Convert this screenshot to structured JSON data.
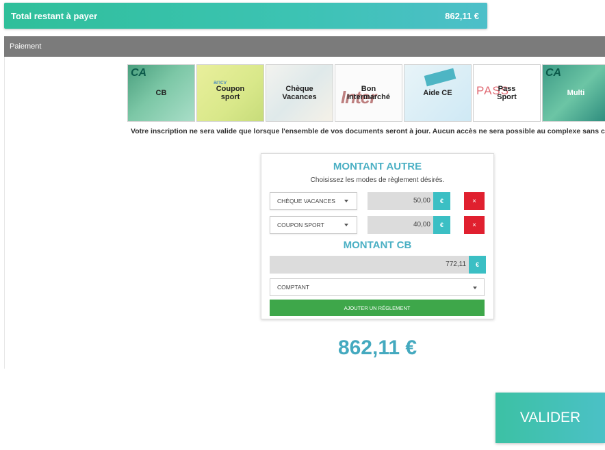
{
  "total": {
    "label": "Total restant à payer",
    "amount": "862,11 €"
  },
  "section": {
    "title": "Paiement"
  },
  "payment_methods": [
    {
      "label": "CB"
    },
    {
      "label": "Coupon\nsport"
    },
    {
      "label": "Chèque\nVacances"
    },
    {
      "label": "Bon\nIntermarché"
    },
    {
      "label": "Aide CE"
    },
    {
      "label": "Pass\nSport"
    },
    {
      "label": "Multi"
    }
  ],
  "notice": "Votre inscription ne sera valide que lorsque l'ensemble de vos documents seront à jour. Aucun accès ne sera possible au complexe sans cela",
  "card": {
    "title": "MONTANT AUTRE",
    "subtitle": "Choisissez les modes de règlement désirés.",
    "rows": [
      {
        "method": "CHÈQUE VACANCES",
        "amount": "50,00",
        "currency": "€",
        "remove": "×"
      },
      {
        "method": "COUPON SPORT",
        "amount": "40,00",
        "currency": "€",
        "remove": "×"
      }
    ],
    "cb_title": "MONTANT CB",
    "cb_amount": "772,11",
    "cb_currency": "€",
    "payment_mode": "COMPTANT",
    "add_button": "AJOUTER UN RÉGLEMENT"
  },
  "grand_total": "862,11 €",
  "validate_button": "VALIDER",
  "colors": {
    "accent": "#44a9bf",
    "teal": "#3bbfc4",
    "danger": "#e0202f",
    "success": "#3ea74a",
    "section_bar": "#7b7b7b"
  }
}
